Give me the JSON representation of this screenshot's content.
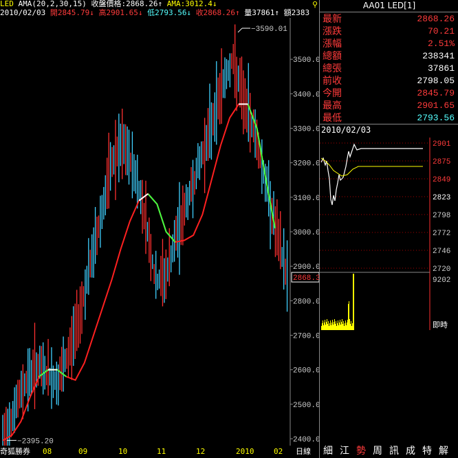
{
  "header": {
    "symbol": "LED",
    "indicator": "AMA(20,2,30,15)",
    "close_label": "收盤價格:2868.26↑",
    "ama_label": "AMA:3012.4↓",
    "date": "2010/02/03",
    "open": "開2845.79↓",
    "high": "高2901.65↓",
    "low": "低2793.56↓",
    "close": "收2868.26↑",
    "volume": "量37861↑",
    "amount": "額2383"
  },
  "main_chart": {
    "y_ticks": [
      "3500.0",
      "3400.0",
      "3300.0",
      "3200.0",
      "3100.0",
      "3000.0",
      "2900.0",
      "2800.0",
      "2700.0",
      "2600.0",
      "2500.0",
      "2400.0"
    ],
    "y_tick_values": [
      3500,
      3400,
      3300,
      3200,
      3100,
      3000,
      2900,
      2800,
      2700,
      2600,
      2500,
      2400
    ],
    "max_annotation": "3590.01",
    "min_annotation": "2395.20",
    "price_tag": "2868.3",
    "x_labels": [
      "奇狐勝券",
      "08",
      "09",
      "10",
      "11",
      "12",
      "2010",
      "02",
      "日線"
    ]
  },
  "chart_data": {
    "type": "candlestick",
    "ylim": [
      2380,
      3620
    ],
    "max": 3590.01,
    "min": 2395.2,
    "last_close": 2868.3,
    "ama": [
      2395,
      2410,
      2450,
      2520,
      2580,
      2600,
      2600,
      2580,
      2570,
      2620,
      2700,
      2780,
      2860,
      2950,
      3030,
      3090,
      3110,
      3080,
      3000,
      2970,
      2975,
      2990,
      3050,
      3150,
      3250,
      3330,
      3370,
      3370,
      3300,
      3150,
      3010
    ],
    "closes": [
      2400,
      2480,
      2560,
      2610,
      2590,
      2560,
      2640,
      2760,
      2900,
      3050,
      3200,
      3250,
      3180,
      3050,
      2850,
      2880,
      3000,
      3100,
      3200,
      3300,
      3420,
      3500,
      3380,
      3300,
      3150,
      3000,
      2870
    ]
  },
  "quote": {
    "title": "AA01 LED[1]",
    "rows": [
      {
        "label": "最新",
        "value": "2868.26",
        "color": "#ff3b3b"
      },
      {
        "label": "漲跌",
        "value": "70.21",
        "color": "#ff3b3b"
      },
      {
        "label": "漲幅",
        "value": "2.51%",
        "color": "#ff3b3b"
      },
      {
        "label": "總額",
        "value": "238341",
        "color": "#ffffff"
      },
      {
        "label": "總張",
        "value": "37861",
        "color": "#ffffff"
      },
      {
        "label": "前收",
        "value": "2798.05",
        "color": "#ffffff"
      },
      {
        "label": "今開",
        "value": "2845.79",
        "color": "#ff3b3b"
      },
      {
        "label": "最高",
        "value": "2901.65",
        "color": "#ff3b3b"
      },
      {
        "label": "最低",
        "value": "2793.56",
        "color": "#55ffff"
      }
    ]
  },
  "intraday": {
    "date": "2010/02/03",
    "y_ticks": [
      "2901",
      "2875",
      "2849",
      "2823",
      "2798",
      "2772",
      "2746",
      "2720"
    ],
    "vol_label": "9202",
    "time_label": "即時"
  },
  "tabs": [
    "細",
    "江",
    "勢",
    "周",
    "訊",
    "成",
    "特",
    "解"
  ],
  "active_tab": "勢"
}
